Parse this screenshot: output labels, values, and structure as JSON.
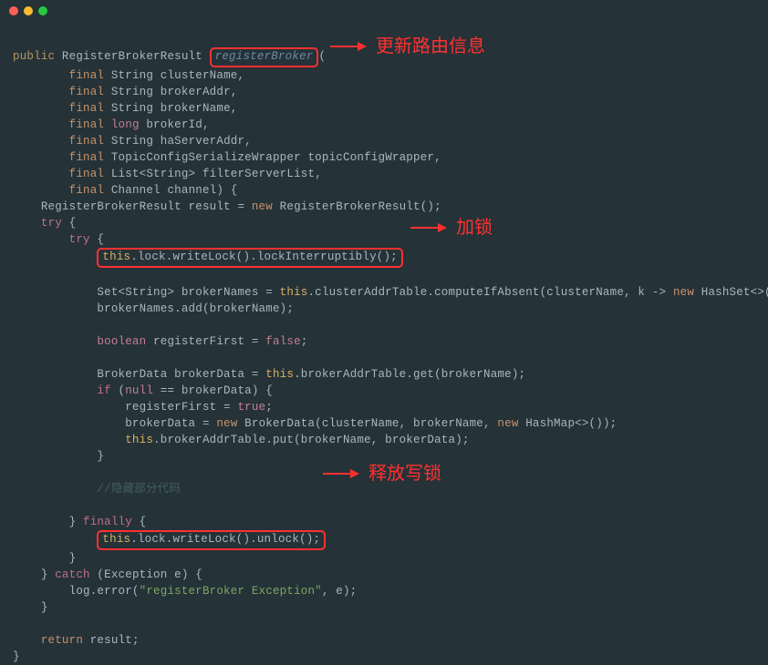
{
  "annotations": {
    "a1": "更新路由信息",
    "a2": "加锁",
    "a3": "释放写锁"
  },
  "code": {
    "l01_public": "public",
    "l01_type": "RegisterBrokerResult",
    "l01_fn": "registerBroker",
    "final": "final",
    "l02_type": "String",
    "l02_var": "clusterName,",
    "l03_type": "String",
    "l03_var": "brokerAddr,",
    "l04_type": "String",
    "l04_var": "brokerName,",
    "l05_type": "long",
    "l05_var": "brokerId,",
    "l06_type": "String",
    "l06_var": "haServerAddr,",
    "l07_type": "TopicConfigSerializeWrapper",
    "l07_var": "topicConfigWrapper,",
    "l08_type": "List<String>",
    "l08_var": "filterServerList,",
    "l09_type": "Channel",
    "l09_var": "channel) {",
    "l10_a": "RegisterBrokerResult result = ",
    "l10_new": "new",
    "l10_b": " RegisterBrokerResult();",
    "try": "try",
    "this": "this",
    "l12": ".lock.writeLock().lockInterruptibly();",
    "l14_a": "Set<String> brokerNames = ",
    "l14_b": ".clusterAddrTable.computeIfAbsent(clusterName, k -> ",
    "l14_c": " HashSet<>());",
    "l15": "brokerNames.add(brokerName);",
    "l17_a": "boolean",
    "l17_b": " registerFirst = ",
    "l17_false": "false",
    "l19_a": "BrokerData brokerData = ",
    "l19_b": ".brokerAddrTable.get(brokerName);",
    "l20_if": "if",
    "l20_null": "null",
    "l20_b": " == brokerData) {",
    "l21_a": "registerFirst = ",
    "l21_true": "true",
    "l22_a": "brokerData = ",
    "l22_b": " BrokerData(clusterName, brokerName, ",
    "l22_c": " HashMap<>());",
    "l23": ".brokerAddrTable.put(brokerName, brokerData);",
    "l24_close": "}",
    "comment": "//隐藏部分代码",
    "finally": "finally",
    "l28": ".lock.writeLock().unlock();",
    "catch": "catch",
    "l30_b": " (Exception e) {",
    "l31_a": "log.error(",
    "l31_str": "\"registerBroker Exception\"",
    "l31_b": ", e);",
    "return": "return",
    "l34_b": " result;",
    "brace_open": " {",
    "brace_close": "}",
    "semicolon": ";",
    "paren_open": "("
  }
}
